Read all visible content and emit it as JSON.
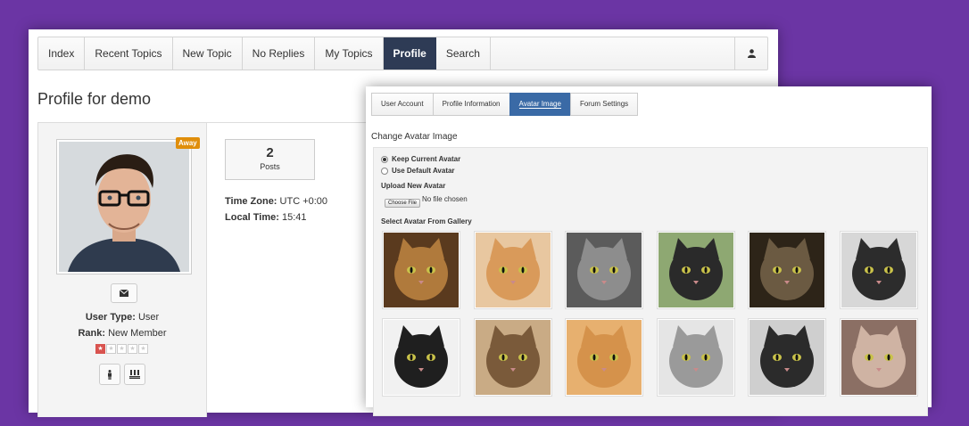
{
  "nav": {
    "items": [
      "Index",
      "Recent Topics",
      "New Topic",
      "No Replies",
      "My Topics",
      "Profile",
      "Search"
    ],
    "active": "Profile",
    "user_icon": "user-icon"
  },
  "profile": {
    "title": "Profile for demo",
    "status_badge": "Away",
    "message_icon": "envelope-icon",
    "user_type_label": "User Type:",
    "user_type_value": "User",
    "rank_label": "Rank:",
    "rank_value": "New Member",
    "stars_filled": 1,
    "stars_total": 5,
    "posts_count": "2",
    "posts_label": "Posts",
    "timezone_label": "Time Zone:",
    "timezone_value": "UTC +0:00",
    "localtime_label": "Local Time:",
    "localtime_value": "15:41",
    "action_icons": [
      "person-icon",
      "group-icon"
    ]
  },
  "settings": {
    "tabs": [
      "User Account",
      "Profile Information",
      "Avatar Image",
      "Forum Settings"
    ],
    "active_tab": "Avatar Image",
    "section_title": "Change Avatar Image",
    "options": [
      {
        "label": "Keep Current Avatar",
        "selected": true
      },
      {
        "label": "Use Default Avatar",
        "selected": false
      }
    ],
    "upload_label": "Upload New Avatar",
    "choose_file": "Choose File",
    "no_file": "No file chosen",
    "gallery_label": "Select Avatar From Gallery",
    "gallery_colors": [
      [
        "#b07a3c",
        "#5a3a1e"
      ],
      [
        "#d99a5a",
        "#e8c7a0"
      ],
      [
        "#8d8d8d",
        "#5b5b5b"
      ],
      [
        "#2a2a2a",
        "#8ea872"
      ],
      [
        "#6b5a42",
        "#2d2418"
      ],
      [
        "#2c2c2c",
        "#d7d7d7"
      ],
      [
        "#1f1f1f",
        "#f1f1f1"
      ],
      [
        "#7a5a3a",
        "#c9ab85"
      ],
      [
        "#d5924b",
        "#e7b06f"
      ],
      [
        "#9a9a9a",
        "#e5e5e5"
      ],
      [
        "#2b2b2b",
        "#cfcfcf"
      ],
      [
        "#cfb3a3",
        "#8b6f64"
      ]
    ]
  }
}
